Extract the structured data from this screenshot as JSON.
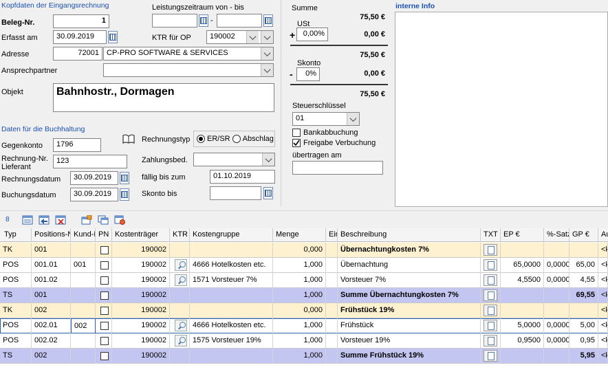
{
  "header": {
    "section_title": "Kopfdaten der Eingangsrechnung",
    "beleg_label": "Beleg-Nr.",
    "beleg_value": "1",
    "erfasst_label": "Erfasst am",
    "erfasst_value": "30.09.2019",
    "adresse_label": "Adresse",
    "adresse_nr": "72001",
    "adresse_name": "CP-PRO SOFTWARE & SERVICES",
    "ansprech_label": "Ansprechpartner",
    "ansprech_value": "",
    "objekt_label": "Objekt",
    "objekt_value": "Bahnhostr., Dormagen",
    "leistung_label": "Leistungszeitraum von - bis",
    "leistung_von": "",
    "leistung_dash": "-",
    "leistung_bis": "",
    "ktr_label": "KTR für OP",
    "ktr_value": "190002"
  },
  "sums": {
    "summe_label": "Summe",
    "summe_value": "75,50 €",
    "ust_label": "USt",
    "ust_sign": "+",
    "ust_pct": "0,00%",
    "ust_value": "0,00 €",
    "sub1": "75,50 €",
    "skonto_label": "Skonto",
    "skonto_sign": "-",
    "skonto_pct": "0%",
    "skonto_value": "0,00 €",
    "total": "75,50 €",
    "steuer_label": "Steuerschlüssel",
    "steuer_value": "01",
    "bankab_label": "Bankabbuchung",
    "freigabe_label": "Freigabe Verbuchung",
    "uebertragen_label": "übertragen am",
    "uebertragen_value": ""
  },
  "intern": {
    "title": "interne Info"
  },
  "buchhaltung": {
    "section_title": "Daten für die Buchhaltung",
    "gegenkonto_label": "Gegenkonto",
    "gegenkonto_value": "1796",
    "rechnr_label1": "Rechnung-Nr.",
    "rechnr_label2": "Lieferant",
    "rechnr_value": "123",
    "rechdat_label": "Rechnungsdatum",
    "rechdat_value": "30.09.2019",
    "buchdat_label": "Buchungsdatum",
    "buchdat_value": "30.09.2019",
    "typ_label": "Rechnungstyp",
    "typ_opt1": "ER/SR",
    "typ_opt2": "Abschlag",
    "zahlung_label": "Zahlungsbed.",
    "zahlung_value": "",
    "faellig_label": "fällig bis zum",
    "faellig_value": "01.10.2019",
    "skontobis_label": "Skonto bis",
    "skontobis_value": ""
  },
  "toolbar": {
    "count": "8"
  },
  "table": {
    "columns": [
      "Typ",
      "Positions-N",
      "Kund-PF",
      "PN",
      "Kostenträger",
      "KTR",
      "Kostengruppe",
      "Menge",
      "Ein",
      "Beschreibung",
      "TXT",
      "EP €",
      "%-Satz",
      "GP €",
      "Au"
    ],
    "rows": [
      {
        "typ": "TK",
        "pos": "001",
        "kund": "",
        "kt": "190002",
        "kg": "",
        "menge": "0,000",
        "desc": "Übernachtungkosten 7%",
        "ep": "",
        "satz": "",
        "gp": "",
        "au": "<k",
        "kind": "tk"
      },
      {
        "typ": "POS",
        "pos": "001.01",
        "kund": "001",
        "kt": "190002",
        "kg": "4666 Hotelkosten etc.",
        "menge": "1,000",
        "desc": "Übernachtung",
        "ep": "65,0000",
        "satz": "0,0000",
        "gp": "65,00",
        "au": "<k",
        "kind": "pos"
      },
      {
        "typ": "POS",
        "pos": "001.02",
        "kund": "",
        "kt": "190002",
        "kg": "1571 Vorsteuer 7%",
        "menge": "1,000",
        "desc": "Vorsteuer 7%",
        "ep": "4,5500",
        "satz": "0,0000",
        "gp": "4,55",
        "au": "<k",
        "kind": "pos"
      },
      {
        "typ": "TS",
        "pos": "001",
        "kund": "",
        "kt": "190002",
        "kg": "",
        "menge": "1,000",
        "desc": "Summe Übernachtungkosten 7%",
        "ep": "",
        "satz": "",
        "gp": "69,55",
        "au": "<k",
        "kind": "ts"
      },
      {
        "typ": "TK",
        "pos": "002",
        "kund": "",
        "kt": "190002",
        "kg": "",
        "menge": "0,000",
        "desc": "Frühstück 19%",
        "ep": "",
        "satz": "",
        "gp": "",
        "au": "<k",
        "kind": "tk"
      },
      {
        "typ": "POS",
        "pos": "002.01",
        "kund": "002",
        "kt": "190002",
        "kg": "4666 Hotelkosten etc.",
        "menge": "1,000",
        "desc": "Frühstück",
        "ep": "5,0000",
        "satz": "0,0000",
        "gp": "5,00",
        "au": "<k",
        "kind": "pos"
      },
      {
        "typ": "POS",
        "pos": "002.02",
        "kund": "",
        "kt": "190002",
        "kg": "1575 Vorsteuer 19%",
        "menge": "1,000",
        "desc": "Vorsteuer 19%",
        "ep": "0,9500",
        "satz": "0,0000",
        "gp": "0,95",
        "au": "<k",
        "kind": "pos"
      },
      {
        "typ": "TS",
        "pos": "002",
        "kund": "",
        "kt": "190002",
        "kg": "",
        "menge": "1,000",
        "desc": "Summe Frühstück 19%",
        "ep": "",
        "satz": "",
        "gp": "5,95",
        "au": "<k",
        "kind": "ts"
      }
    ]
  }
}
